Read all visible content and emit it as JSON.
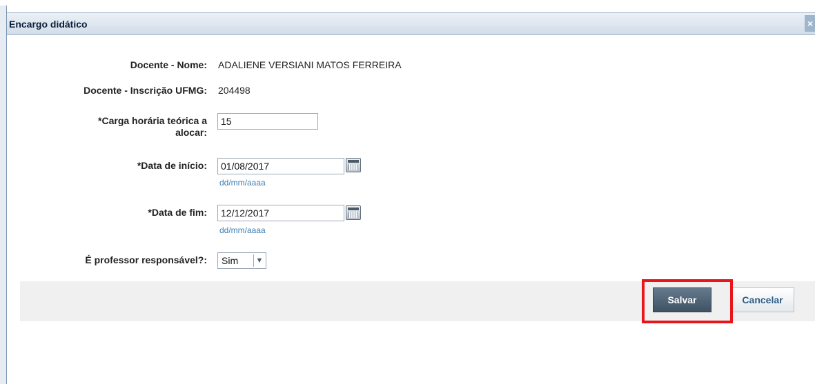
{
  "dialog": {
    "title": "Encargo didático",
    "close_glyph": "×"
  },
  "form": {
    "name_label": "Docente - Nome:",
    "name_value": "ADALIENE VERSIANI MATOS FERREIRA",
    "inscricao_label": "Docente - Inscrição UFMG:",
    "inscricao_value": "204498",
    "carga_label_line1": "*Carga horária teórica a",
    "carga_label_line2": "alocar:",
    "carga_value": "15",
    "data_inicio_label": "*Data de início:",
    "data_inicio_value": "01/08/2017",
    "data_inicio_hint": "dd/mm/aaaa",
    "data_fim_label": "*Data de fim:",
    "data_fim_value": "12/12/2017",
    "data_fim_hint": "dd/mm/aaaa",
    "responsavel_label": "É professor responsável?:",
    "responsavel_value": "Sim",
    "responsavel_options": [
      "Sim"
    ]
  },
  "buttons": {
    "save_label": "Salvar",
    "cancel_label": "Cancelar"
  },
  "colors": {
    "highlight": "#e8151b",
    "save_button": "#4f6275",
    "hint_text": "#3f7fb4"
  },
  "icons": {
    "calendar": "calendar-icon",
    "dropdown": "chevron-down-icon",
    "close": "close-icon"
  }
}
